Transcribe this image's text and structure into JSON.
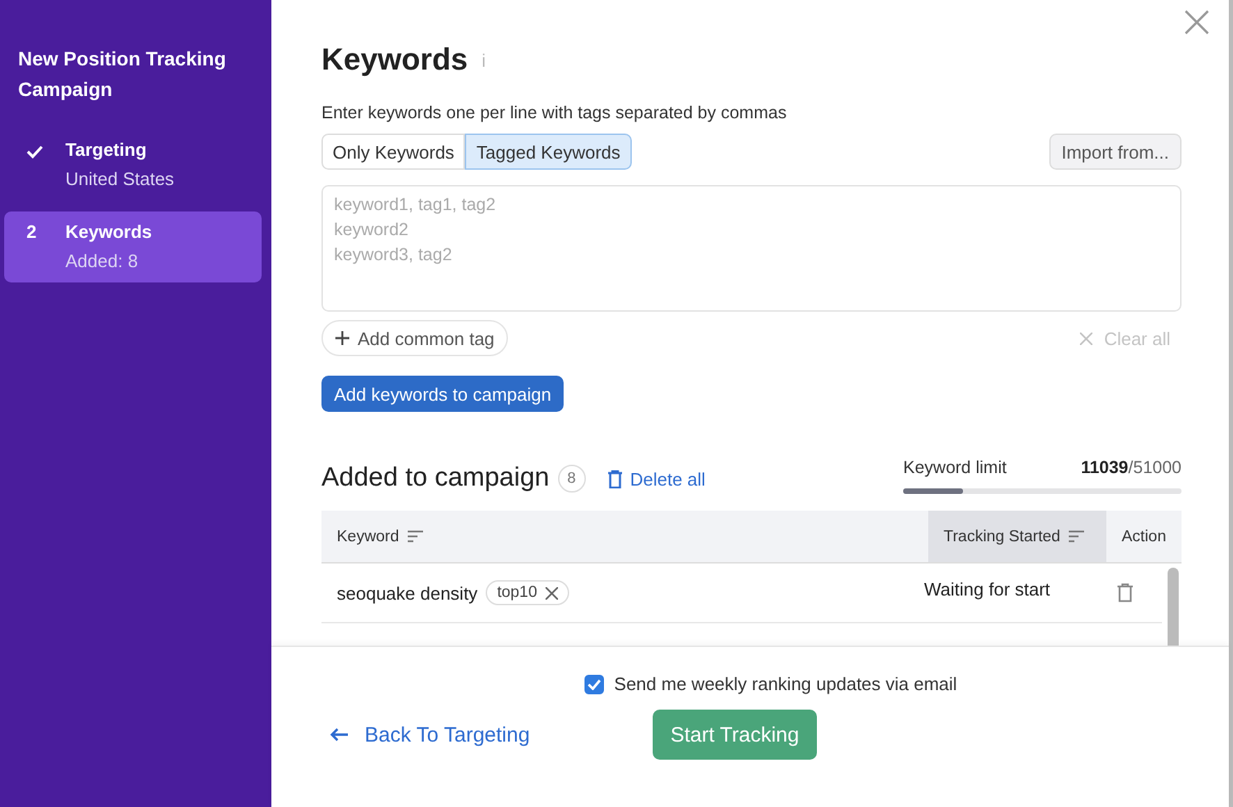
{
  "sidebar": {
    "title": "New Position Tracking Campaign",
    "steps": [
      {
        "kind": "done",
        "label": "Targeting",
        "sub": "United States",
        "selected": false
      },
      {
        "kind": "number",
        "marker": "2",
        "label": "Keywords",
        "sub": "Added: 8",
        "selected": true
      }
    ]
  },
  "main": {
    "title": "Keywords",
    "info": "i",
    "hint": "Enter keywords one per line with tags separated by commas",
    "tabs": [
      {
        "label": "Only Keywords",
        "selected": false
      },
      {
        "label": "Tagged Keywords",
        "selected": true
      }
    ],
    "import_button": "Import from...",
    "textarea": {
      "placeholder": "keyword1, tag1, tag2\nkeyword2\nkeyword3, tag2"
    },
    "add_tag_button": "Add common tag",
    "clear_all": "Clear all",
    "clear_disabled": true,
    "add_button": "Add keywords to campaign"
  },
  "added": {
    "title": "Added to campaign",
    "count": "8",
    "delete_all": "Delete all",
    "limit_label": "Keyword limit",
    "limit_used": "11039",
    "limit_total": "/51000",
    "level": 0.216,
    "table": {
      "columns": [
        {
          "label": "Keyword",
          "active": false
        },
        {
          "label": "Tracking Started",
          "active": true
        },
        {
          "label": "Action",
          "active": false
        }
      ],
      "rows": [
        {
          "keyword": "seoquake density",
          "tag": "top10",
          "status": "Waiting for start"
        }
      ]
    }
  },
  "footer": {
    "checkbox": {
      "label": "Send me weekly ranking updates via email",
      "checked": true
    },
    "back": "Back To Targeting",
    "start": "Start Tracking"
  }
}
